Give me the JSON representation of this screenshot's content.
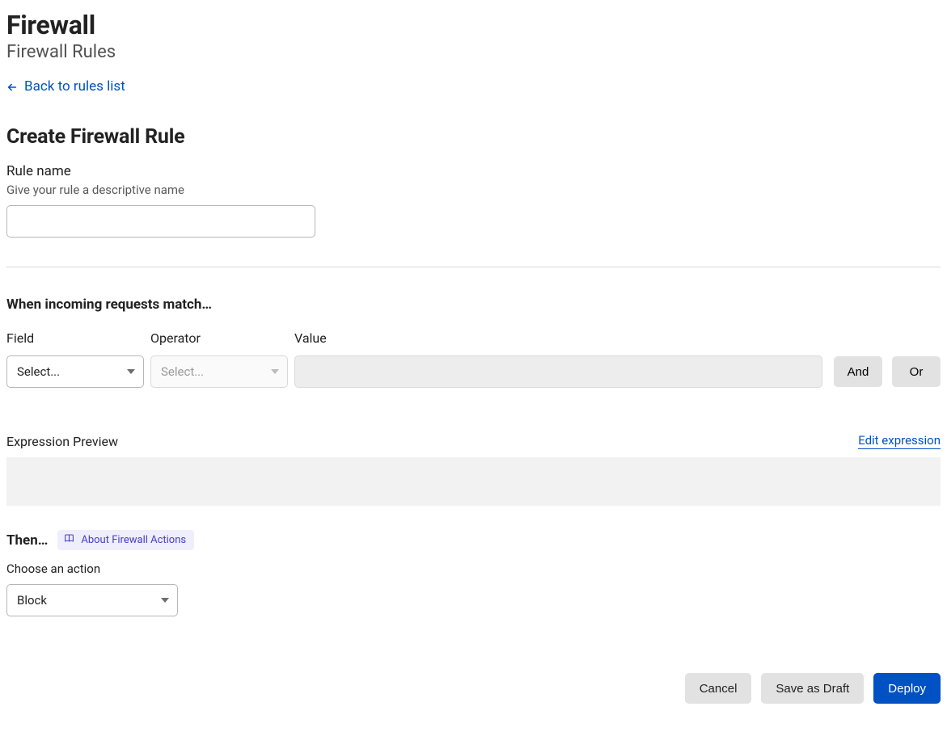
{
  "header": {
    "title": "Firewall",
    "subtitle": "Firewall Rules",
    "back_link": "Back to rules list"
  },
  "create": {
    "heading": "Create Firewall Rule",
    "rule_name_label": "Rule name",
    "rule_name_help": "Give your rule a descriptive name",
    "rule_name_value": ""
  },
  "match": {
    "heading": "When incoming requests match…",
    "field_label": "Field",
    "operator_label": "Operator",
    "value_label": "Value",
    "field_placeholder": "Select...",
    "operator_placeholder": "Select...",
    "value_value": "",
    "and_label": "And",
    "or_label": "Or"
  },
  "expression": {
    "label": "Expression Preview",
    "edit_link": "Edit expression",
    "value": ""
  },
  "then": {
    "heading": "Then…",
    "about_link": "About Firewall Actions",
    "choose_action_label": "Choose an action",
    "action_selected": "Block"
  },
  "footer": {
    "cancel": "Cancel",
    "save_draft": "Save as Draft",
    "deploy": "Deploy"
  }
}
